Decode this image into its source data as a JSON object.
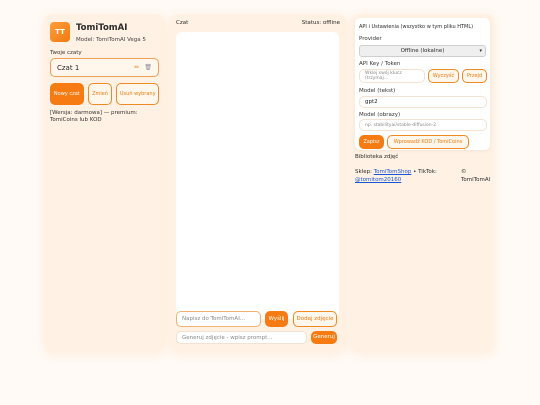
{
  "sidebar": {
    "avatar": "TT",
    "title": "TomiTomAI",
    "subtitle": "Model: TomiTomAI Vega 5",
    "chats_label": "Twoje czaty",
    "chat_item": "Czat 1",
    "new_chat": "Nowy czat",
    "rename": "Zmień",
    "delete_selected": "Usuń wybrany",
    "version_note": "[Wersja: darmowa] — premium: TomiCoins lub KOD",
    "edit_icon": "pencil-icon",
    "delete_icon": "trash-icon"
  },
  "chat": {
    "title": "Czat",
    "status": "Status: offline",
    "message_placeholder": "Napisz do TomiTomAI...",
    "send": "Wyślij",
    "add_image": "Dodaj zdjęcie",
    "image_placeholder": "Generuj zdjęcie - wpisz prompt...",
    "generate": "Generuj"
  },
  "settings": {
    "title": "API i Ustawienia (wszystko w tym pliku HTML)",
    "provider_label": "Provider",
    "provider_value": "Offline (lokalne)",
    "api_label": "API Key / Token",
    "api_placeholder": "Wklej swój klucz (trzymaj...",
    "clear": "Wyczyść",
    "test": "Przejd",
    "model_text_label": "Model (tekst)",
    "model_text_value": "gpt2",
    "model_image_label": "Model (obrazy)",
    "model_image_placeholder": "np. stabilityai/stable-diffusion-2",
    "save": "Zapisz",
    "redeem": "Wprowadź KOD / TomiCoins"
  },
  "footer": {
    "library": "Biblioteka zdjęć",
    "shop_prefix": "Sklep: ",
    "shop_link": "TomiTomShop",
    "tiktok_prefix": " • TikTok:",
    "tiktok_link": "@tomitom20160",
    "copyright": "© TomiTomAI"
  },
  "colors": {
    "accent": "#f57b12",
    "panel": "#fff1e3",
    "link": "#1a55d6"
  }
}
